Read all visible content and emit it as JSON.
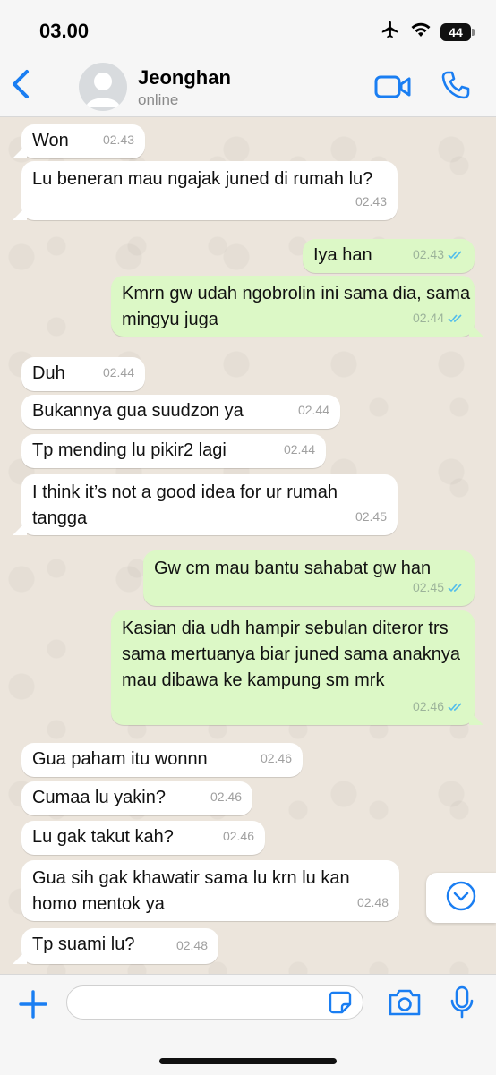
{
  "status_bar": {
    "time": "03.00",
    "battery": "44"
  },
  "header": {
    "contact_name": "Jeonghan",
    "contact_status": "online"
  },
  "colors": {
    "accent": "#1a7ef2",
    "incoming_bubble": "#ffffff",
    "outgoing_bubble": "#dcf8c6",
    "chat_background": "#ece5dc",
    "read_ticks": "#53bdeb"
  },
  "messages": [
    {
      "direction": "in",
      "text": "Won",
      "time": "02.43"
    },
    {
      "direction": "in",
      "text": "Lu beneran mau ngajak juned di rumah lu?",
      "time": "02.43"
    },
    {
      "direction": "out",
      "text": "Iya han",
      "time": "02.43",
      "status": "read"
    },
    {
      "direction": "out",
      "text": "Kmrn gw udah ngobrolin ini sama dia, sama mingyu juga",
      "time": "02.44",
      "status": "read"
    },
    {
      "direction": "in",
      "text": "Duh",
      "time": "02.44"
    },
    {
      "direction": "in",
      "text": "Bukannya gua suudzon ya",
      "time": "02.44"
    },
    {
      "direction": "in",
      "text": "Tp mending lu pikir2 lagi",
      "time": "02.44"
    },
    {
      "direction": "in",
      "text": "I think it’s not a good idea for ur rumah tangga",
      "time": "02.45"
    },
    {
      "direction": "out",
      "text": "Gw cm mau bantu sahabat gw han",
      "time": "02.45",
      "status": "read"
    },
    {
      "direction": "out",
      "text": "Kasian dia udh hampir sebulan diteror trs sama mertuanya biar juned sama anaknya mau dibawa ke kampung sm mrk",
      "time": "02.46",
      "status": "read"
    },
    {
      "direction": "in",
      "text": "Gua paham itu wonnn",
      "time": "02.46"
    },
    {
      "direction": "in",
      "text": "Cumaa lu yakin?",
      "time": "02.46"
    },
    {
      "direction": "in",
      "text": "Lu gak takut kah?",
      "time": "02.46"
    },
    {
      "direction": "in",
      "text": "Gua sih gak khawatir sama lu krn lu kan homo mentok ya",
      "time": "02.48"
    },
    {
      "direction": "in",
      "text": "Tp suami lu?",
      "time": "02.48"
    }
  ],
  "input": {
    "placeholder": "",
    "value": ""
  },
  "icons": {
    "back": "chevron-left-icon",
    "video": "video-camera-icon",
    "call": "phone-icon",
    "scroll_down": "chevron-down-circle-icon",
    "add": "plus-icon",
    "sticker": "sticker-icon",
    "camera": "camera-icon",
    "mic": "microphone-icon"
  }
}
